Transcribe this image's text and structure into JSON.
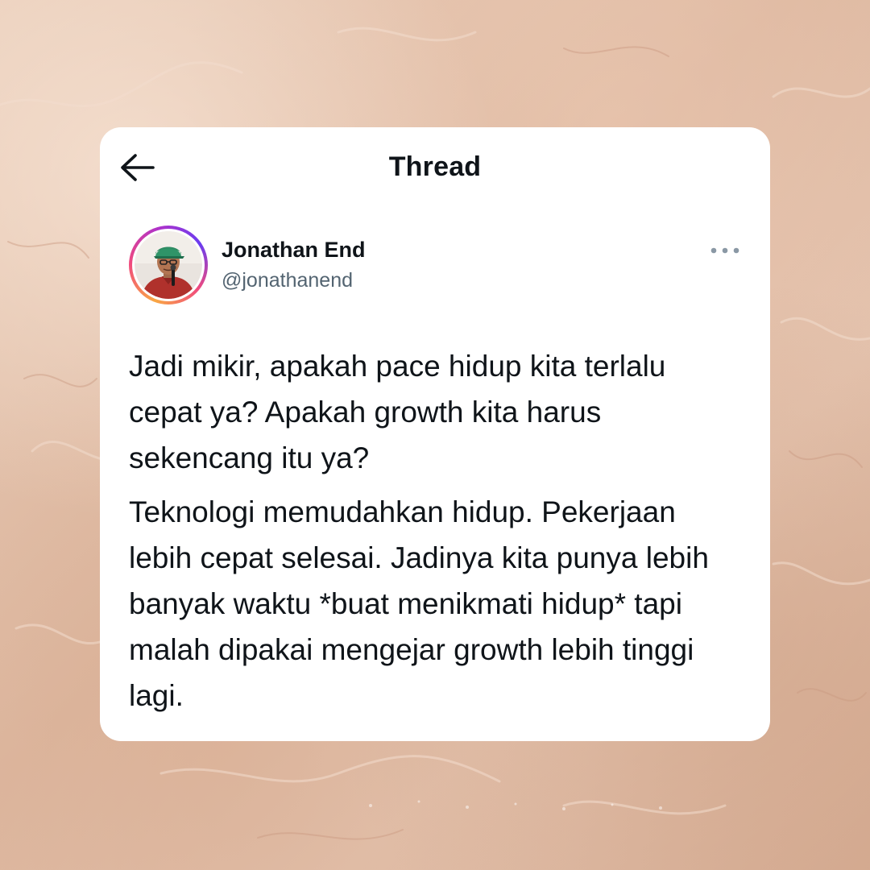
{
  "header": {
    "title": "Thread",
    "back_icon": "arrow-left-icon"
  },
  "author": {
    "display_name": "Jonathan End",
    "handle": "@jonathanend",
    "avatar_ring_colors": [
      "#f9a743",
      "#f04a7e",
      "#b032c9"
    ]
  },
  "more_icon": "more-horizontal-icon",
  "tweet": {
    "paragraphs": [
      "Jadi mikir, apakah pace hidup kita terlalu cepat ya? Apakah growth kita harus sekencang itu ya?",
      "Teknologi memudahkan hidup. Pekerjaan lebih cepat selesai. Jadinya kita punya lebih banyak waktu *buat menikmati hidup* tapi malah dipakai mengejar growth lebih tinggi lagi."
    ]
  },
  "colors": {
    "text_primary": "#0f1419",
    "text_secondary": "#536471",
    "card_background": "#ffffff",
    "page_background": "#e3c2ad"
  }
}
